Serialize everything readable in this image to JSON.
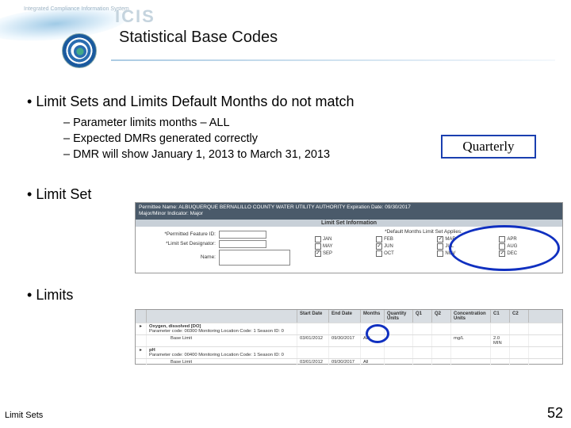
{
  "header": {
    "system_abbrev": "ICIS",
    "system_full": "Integrated Compliance Information System",
    "title": "Statistical Base Codes"
  },
  "bullets": {
    "b1": "Limit Sets and Limits Default Months do not match",
    "b1_subs": {
      "s1": "Parameter limits months – ALL",
      "s2": "Expected DMRs generated correctly",
      "s3": "DMR will show January 1, 2013 to March 31, 2013"
    },
    "b2": "Limit Set",
    "b3": "Limits"
  },
  "callout": {
    "label": "Quarterly"
  },
  "limitset": {
    "perm_name_line": "Permittee Name: ALBUQUERQUE BERNALILLO COUNTY WATER UTILITY AUTHORITY  Expiration Date: 09/30/2017",
    "major_line": "Major/Minor Indicator: Major",
    "section": "Limit Set Information",
    "fields": {
      "permfeat": "*Permitted Feature ID:",
      "lsd": "*Limit Set Designator:",
      "name": "Name:"
    },
    "right_label": "*Default Months Limit Set Applies:",
    "months": [
      "JAN",
      "FEB",
      "MAR",
      "APR",
      "MAY",
      "JUN",
      "JUL",
      "AUG",
      "SEP",
      "OCT",
      "NOV",
      "DEC"
    ],
    "checked": [
      "MAR",
      "JUN",
      "SEP",
      "DEC"
    ]
  },
  "limits": {
    "headers": [
      "",
      "Start Date",
      "End Date",
      "Months",
      "Quantity Units",
      "Q1",
      "Q2",
      "Concentration Units",
      "C1",
      "C2"
    ],
    "rows": [
      {
        "param_title": "Oxygen, dissolved [DO]",
        "param_sub": "Parameter code: 00300 Monitoring Location Code: 1 Season ID: 0",
        "base": "Base Limit",
        "sd": "03/01/2012",
        "ed": "09/30/2017",
        "months": "ALL",
        "qu": "",
        "q1": "",
        "q2": "",
        "cu": "mg/L",
        "c1": "2.0 MIN",
        "c2": ""
      },
      {
        "param_title": "pH",
        "param_sub": "Parameter code: 00400 Monitoring Location Code: 1 Season ID: 0",
        "base": "Base Limit",
        "sd": "03/01/2012",
        "ed": "09/30/2017",
        "months": "All",
        "qu": "",
        "q1": "",
        "q2": "",
        "cu": "",
        "c1": "",
        "c2": ""
      }
    ]
  },
  "footer": {
    "left": "Limit Sets",
    "right": "52"
  }
}
